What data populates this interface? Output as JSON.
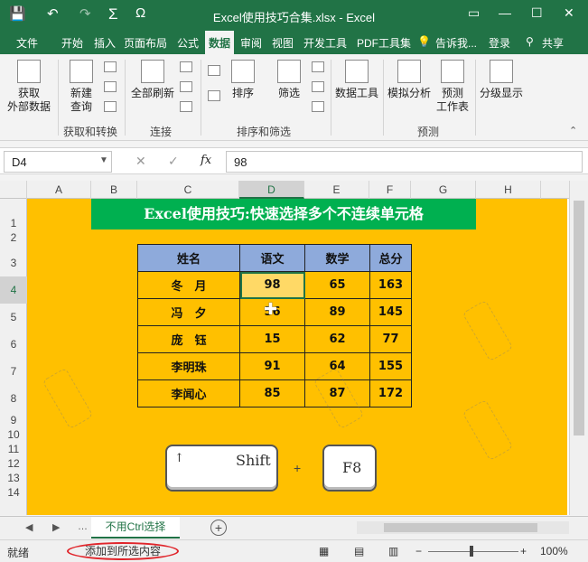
{
  "window": {
    "title": "Excel使用技巧合集.xlsx - Excel",
    "quick_access": [
      "💾",
      "↶",
      "↷",
      "Σ",
      "Ω"
    ],
    "controls": [
      "▭",
      "—",
      "☐",
      "✕"
    ]
  },
  "tabs": [
    "文件",
    "开始",
    "插入",
    "页面布局",
    "公式",
    "数据",
    "审阅",
    "视图",
    "开发工具",
    "PDF工具集"
  ],
  "active_tab": "数据",
  "tell_me": "告诉我...",
  "login": "登录",
  "share": "共享",
  "ribbon": {
    "get_external": "获取\n外部数据",
    "new_query": "新建\n查询",
    "refresh_all": "全部刷新",
    "sort": "排序",
    "filter": "筛选",
    "data_tools": "数据工具",
    "what_if": "模拟分析",
    "forecast_sheet": "预测\n工作表",
    "outline": "分级显示",
    "group_get_transform": "获取和转换",
    "group_connections": "连接",
    "group_sort_filter": "排序和筛选",
    "group_forecast": "预测"
  },
  "formula_bar": {
    "cell_ref": "D4",
    "fx": "fx",
    "value": "98"
  },
  "columns": [
    "A",
    "B",
    "C",
    "D",
    "E",
    "F",
    "G",
    "H"
  ],
  "selected_column": "D",
  "rows": [
    "1",
    "2",
    "3",
    "4",
    "5",
    "6",
    "7",
    "8",
    "9",
    "10",
    "11",
    "12",
    "13",
    "14"
  ],
  "selected_row": "4",
  "banner": "Excel使用技巧:快速选择多个不连续单元格",
  "table": {
    "headers": [
      "姓名",
      "语文",
      "数学",
      "总分"
    ],
    "rows": [
      [
        "冬　月",
        "98",
        "65",
        "163"
      ],
      [
        "冯　夕",
        "56",
        "89",
        "145"
      ],
      [
        "庞　钰",
        "15",
        "62",
        "77"
      ],
      [
        "李明珠",
        "91",
        "64",
        "155"
      ],
      [
        "李闻心",
        "85",
        "87",
        "172"
      ]
    ]
  },
  "keys": {
    "shift_arrow": "↑",
    "shift": "Shift",
    "plus": "+",
    "f8": "F8"
  },
  "sheet_tab": "不用Ctrl选择",
  "status": {
    "ready": "就绪",
    "mode": "添加到所选内容",
    "zoom": "100%"
  },
  "colors": {
    "excel_green": "#217346",
    "sheet_bg": "#ffc000",
    "banner_bg": "#00b050",
    "header_bg": "#8eaadb",
    "status_circle": "#e0252b"
  }
}
